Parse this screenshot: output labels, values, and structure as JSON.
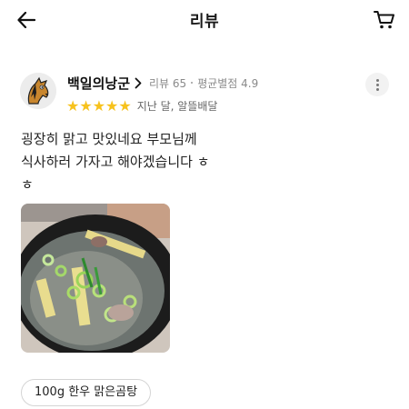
{
  "header": {
    "title": "리뷰",
    "back_icon": "arrow-left-icon",
    "cart_icon": "cart-icon"
  },
  "review": {
    "author": "백일의낭군",
    "review_count_label": "리뷰 65",
    "avg_rating_label": "평균별점 4.9",
    "rating": 5,
    "rating_max": 5,
    "date_and_type": "지난 달, 알뜰배달",
    "text": "굉장히 맑고 맛있네요 부모님께\n식사하러 가자고 해야겠습니다 ㅎ\nㅎ",
    "photo_alt": "맑은 곰탕 사진",
    "menu_tag": "100g 한우 맑은곰탕"
  },
  "colors": {
    "star": "#f7c21d",
    "meta_text": "#8a8a8a"
  }
}
